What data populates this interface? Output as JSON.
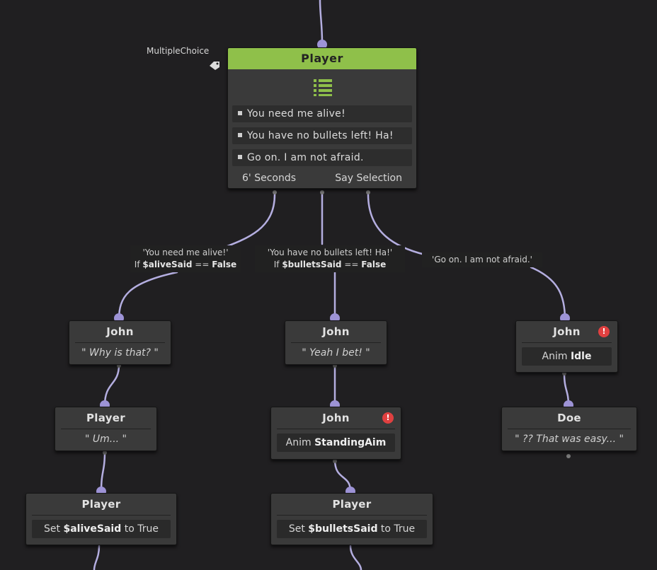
{
  "tag": {
    "label": "MultipleChoice",
    "icon": "tag-icon"
  },
  "main_node": {
    "title": "Player",
    "icon": "list-icon",
    "header_color": "#8fc04a",
    "choices": [
      "You need me alive!",
      "You have no bullets left! Ha!",
      "Go on. I am not afraid."
    ],
    "footer_left": "6' Seconds",
    "footer_right": "Say Selection"
  },
  "edges": {
    "left": {
      "text": "'You need me alive!'",
      "cond_prefix": "If ",
      "cond_var": "$aliveSaid",
      "cond_mid": " == ",
      "cond_val": "False"
    },
    "middle": {
      "text": "'You have no bullets left! Ha!'",
      "cond_prefix": "If ",
      "cond_var": "$bulletsSaid",
      "cond_mid": " == ",
      "cond_val": "False"
    },
    "right": {
      "text": "'Go on. I am not afraid.'"
    }
  },
  "nodes": {
    "john_left": {
      "title": "John",
      "line": "\" Why is that? \""
    },
    "john_mid": {
      "title": "John",
      "line": "\" Yeah I bet! \""
    },
    "john_right": {
      "title": "John",
      "anim_prefix": "Anim ",
      "anim_name": "Idle",
      "warning": "!"
    },
    "player_left": {
      "title": "Player",
      "line": "\" Um... \""
    },
    "john_mid2": {
      "title": "John",
      "anim_prefix": "Anim ",
      "anim_name": "StandingAim",
      "warning": "!"
    },
    "doe": {
      "title": "Doe",
      "line": "\" ?? That was easy... \""
    },
    "player_set_left": {
      "title": "Player",
      "prefix": "Set ",
      "var": "$aliveSaid",
      "suffix": " to True"
    },
    "player_set_mid": {
      "title": "Player",
      "prefix": "Set ",
      "var": "$bulletsSaid",
      "suffix": " to True"
    }
  },
  "colors": {
    "wire": "#9d93d6",
    "background": "#201f21",
    "warning": "#e04040"
  }
}
